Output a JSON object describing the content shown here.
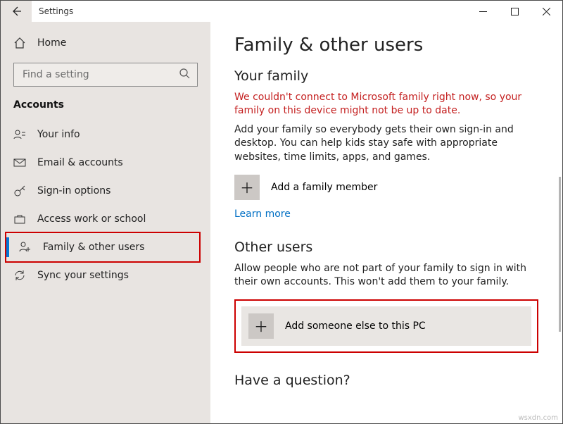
{
  "window": {
    "title": "Settings"
  },
  "sidebar": {
    "home": "Home",
    "search_placeholder": "Find a setting",
    "section": "Accounts",
    "items": [
      {
        "label": "Your info"
      },
      {
        "label": "Email & accounts"
      },
      {
        "label": "Sign-in options"
      },
      {
        "label": "Access work or school"
      },
      {
        "label": "Family & other users"
      },
      {
        "label": "Sync your settings"
      }
    ]
  },
  "main": {
    "heading": "Family & other users",
    "family": {
      "title": "Your family",
      "error": "We couldn't connect to Microsoft family right now, so your family on this device might not be up to date.",
      "desc": "Add your family so everybody gets their own sign-in and desktop. You can help kids stay safe with appropriate websites, time limits, apps, and games.",
      "add_label": "Add a family member",
      "learn_more": "Learn more"
    },
    "other": {
      "title": "Other users",
      "desc": "Allow people who are not part of your family to sign in with their own accounts. This won't add them to your family.",
      "add_label": "Add someone else to this PC"
    },
    "question": "Have a question?"
  },
  "watermark": "wsxdn.com"
}
